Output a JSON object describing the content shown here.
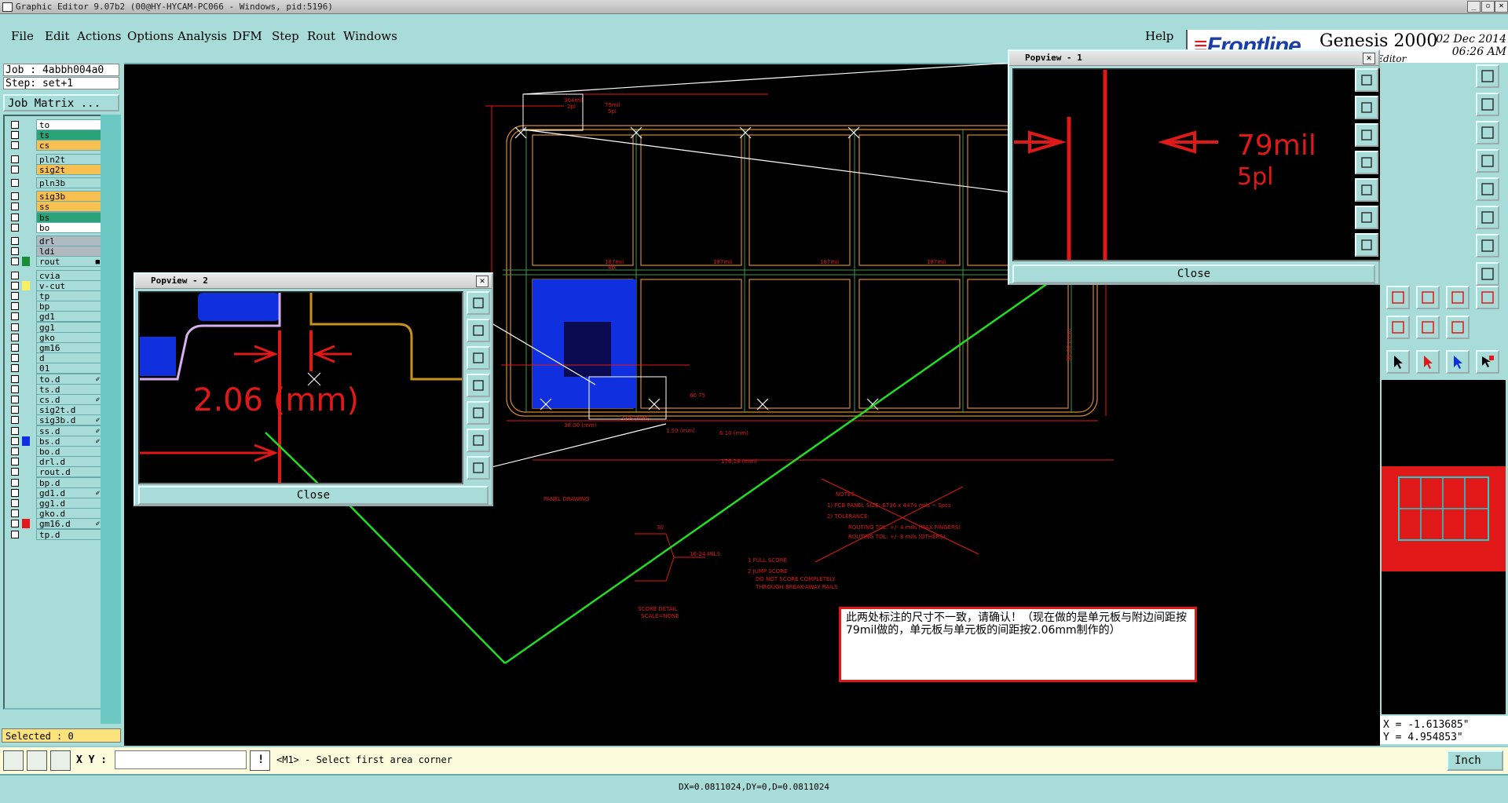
{
  "window": {
    "title": "Graphic Editor 9.07b2 (00@HY-HYCAM-PC066 - Windows, pid:5196)",
    "buttons": [
      "_",
      "▫",
      "✕"
    ]
  },
  "menu": {
    "items": [
      "File",
      "Edit",
      "Actions",
      "Options",
      "Analysis",
      "DFM",
      "Step",
      "Rout",
      "Windows"
    ],
    "help": "Help"
  },
  "branding": {
    "logo": "Frontline",
    "product": "Genesis 2000",
    "subtitle": "Graphic Editor",
    "date": "02 Dec 2014",
    "time": "06:26 AM"
  },
  "job": {
    "job_line": "Job : 4abbh004a0",
    "step_line": "Step: set+1",
    "matrix_button": "Job Matrix ..."
  },
  "layers": [
    {
      "name": "to",
      "color": "#ffffff",
      "swatch": ""
    },
    {
      "name": "ts",
      "color": "#2aa37a",
      "swatch": ""
    },
    {
      "name": "cs",
      "color": "#f8c050",
      "swatch": ""
    },
    {
      "name": "pln2t",
      "color": "#a8dcd9",
      "swatch": ""
    },
    {
      "name": "sig2t",
      "color": "#f8c050",
      "swatch": ""
    },
    {
      "name": "pln3b",
      "color": "#a8dcd9",
      "swatch": ""
    },
    {
      "name": "sig3b",
      "color": "#f8c050",
      "swatch": ""
    },
    {
      "name": "ss",
      "color": "#f8c050",
      "swatch": ""
    },
    {
      "name": "bs",
      "color": "#2aa37a",
      "swatch": ""
    },
    {
      "name": "bo",
      "color": "#ffffff",
      "swatch": ""
    },
    {
      "name": "drl",
      "color": "#b0b8c0",
      "swatch": ""
    },
    {
      "name": "ldi",
      "color": "#b0b8c0",
      "swatch": ""
    },
    {
      "name": "rout",
      "color": "#a8dcd9",
      "swatch": "#1b8c38",
      "mark": "■"
    },
    {
      "name": "cvia",
      "color": "#a8dcd9",
      "swatch": ""
    },
    {
      "name": "v-cut",
      "color": "#a8dcd9",
      "swatch": "#f8f060"
    },
    {
      "name": "tp",
      "color": "#a8dcd9",
      "swatch": ""
    },
    {
      "name": "bp",
      "color": "#a8dcd9",
      "swatch": ""
    },
    {
      "name": "gd1",
      "color": "#a8dcd9",
      "swatch": ""
    },
    {
      "name": "gg1",
      "color": "#a8dcd9",
      "swatch": ""
    },
    {
      "name": "gko",
      "color": "#a8dcd9",
      "swatch": ""
    },
    {
      "name": "gm16",
      "color": "#a8dcd9",
      "swatch": ""
    },
    {
      "name": "d",
      "color": "#a8dcd9",
      "swatch": ""
    },
    {
      "name": "01",
      "color": "#a8dcd9",
      "swatch": ""
    },
    {
      "name": "to.d",
      "color": "#a8dcd9",
      "swatch": "",
      "mark": "✐"
    },
    {
      "name": "ts.d",
      "color": "#a8dcd9",
      "swatch": ""
    },
    {
      "name": "cs.d",
      "color": "#a8dcd9",
      "swatch": "",
      "mark": "✐"
    },
    {
      "name": "sig2t.d",
      "color": "#a8dcd9",
      "swatch": ""
    },
    {
      "name": "sig3b.d",
      "color": "#a8dcd9",
      "swatch": "",
      "mark": "✐"
    },
    {
      "name": "ss.d",
      "color": "#a8dcd9",
      "swatch": "",
      "mark": "✐"
    },
    {
      "name": "bs.d",
      "color": "#a8dcd9",
      "swatch": "#1030e0",
      "mark": "✐"
    },
    {
      "name": "bo.d",
      "color": "#a8dcd9",
      "swatch": ""
    },
    {
      "name": "drl.d",
      "color": "#a8dcd9",
      "swatch": ""
    },
    {
      "name": "rout.d",
      "color": "#a8dcd9",
      "swatch": ""
    },
    {
      "name": "bp.d",
      "color": "#a8dcd9",
      "swatch": ""
    },
    {
      "name": "gd1.d",
      "color": "#a8dcd9",
      "swatch": "",
      "mark": "✐"
    },
    {
      "name": "gg1.d",
      "color": "#a8dcd9",
      "swatch": ""
    },
    {
      "name": "gko.d",
      "color": "#a8dcd9",
      "swatch": ""
    },
    {
      "name": "gm16.d",
      "color": "#a8dcd9",
      "swatch": "#e01818",
      "mark": "✐"
    },
    {
      "name": "tp.d",
      "color": "#a8dcd9",
      "swatch": ""
    }
  ],
  "selected": "Selected : 0",
  "popview1": {
    "title": "Popview - 1",
    "label_main": "79mil",
    "label_sub": "5pl",
    "close": "Close"
  },
  "popview2": {
    "title": "Popview - 2",
    "label": "2.06 (mm)",
    "close": "Close"
  },
  "drawing": {
    "panel_drawing": "PANEL DRAWING",
    "notes": "NOTES:",
    "note1": "1)  PCB PANEL SIZE: 6736 x 4474 mils ~ Spcs",
    "note2": "2)  TOLERANCE:",
    "tol1": "ROUTING TOL: +/- 4 mils (MAX FINGERS)",
    "tol2": "ROUTING TOL: +/- 8 mils (OTHERS)",
    "score1": "1  FULL SCORE",
    "score2": "2  JUMP SCORE",
    "score2a": "DO NOT SCORE COMPLETELY",
    "score2b": "THROUGH BREAK-AWAY RAILS",
    "score_detail": "SCORE DETAIL",
    "score_scale": "SCALE=NONE",
    "dim_total": "176.14 (mm)",
    "dim_a": "38.00 (mm)",
    "dim_b": "2.06 (mm)",
    "dim_c": "1.50 (mm)",
    "dim_d": "6.10 (mm)",
    "dim_e": "60.75",
    "dim_v": "56.00 (mm)",
    "angle": "30",
    "score_mils": "16-24 MILS",
    "top_label": "304mil",
    "top_label2": "2pl",
    "lbl_79": "79mil",
    "lbl_5pl": "5pl",
    "lbl_187": "187mil",
    "lbl_4pl": "4pl"
  },
  "annotation": "此两处标注的尺寸不一致，请确认！（现在做的是单元板与附边间距按79mil做的，单元板与单元板的间距按2.06mm制作的）",
  "coords": {
    "x": "X = -1.613685\"",
    "y": "Y = 4.954853\""
  },
  "command": {
    "xy_label": "X Y :",
    "xy_value": "",
    "prompt": "<M1> - Select first area corner",
    "unit": "Inch"
  },
  "status": "DX=0.0811024,DY=0,D=0.0811024",
  "colors": {
    "panel_bg": "#a8dcd9",
    "accent_red": "#e01818",
    "arrow_green": "#22dd22",
    "copper_blue": "#1030e0"
  }
}
